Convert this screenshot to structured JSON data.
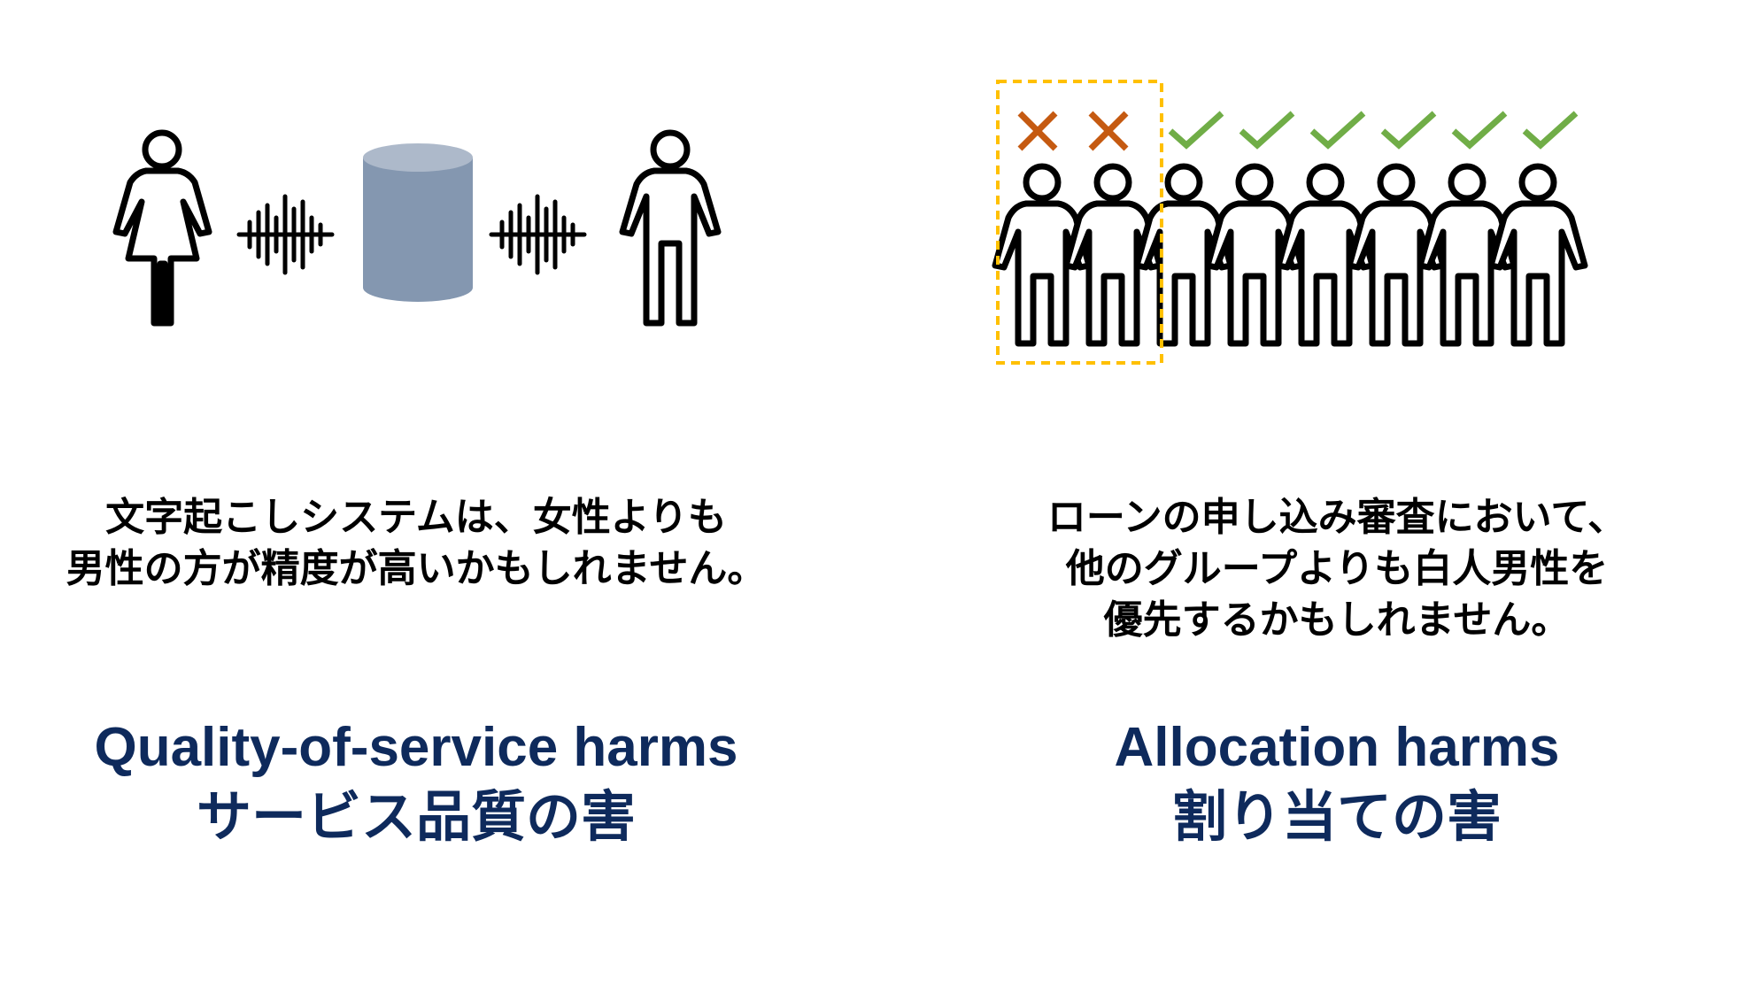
{
  "colors": {
    "title": "#0e2a5c",
    "database": "#8497b0",
    "database_top": "#adb9ca",
    "highlight_box": "#ffc000",
    "cross": "#c55a11",
    "check": "#70ad47",
    "figure_stroke": "#000000"
  },
  "quality_of_service": {
    "illustration": {
      "left_figure": "woman-icon",
      "left_wave": "sound-wave-icon",
      "center": "database-icon",
      "right_wave": "sound-wave-icon",
      "right_figure": "man-icon"
    },
    "caption_lines": [
      "文字起こしシステムは、女性よりも",
      "男性の方が精度が高いかもしれません。"
    ],
    "title_en": "Quality-of-service harms",
    "title_ja": "サービス品質の害"
  },
  "allocation": {
    "illustration": {
      "people_count": 8,
      "marks": [
        "cross",
        "cross",
        "check",
        "check",
        "check",
        "check",
        "check",
        "check"
      ],
      "highlighted_people": 2,
      "figure": "man-icon",
      "cross_icon": "cross-icon",
      "check_icon": "check-icon"
    },
    "caption_lines": [
      "ローンの申し込み審査において、",
      "他のグループよりも白人男性を",
      "優先するかもしれません。"
    ],
    "title_en": "Allocation harms",
    "title_ja": "割り当ての害"
  }
}
